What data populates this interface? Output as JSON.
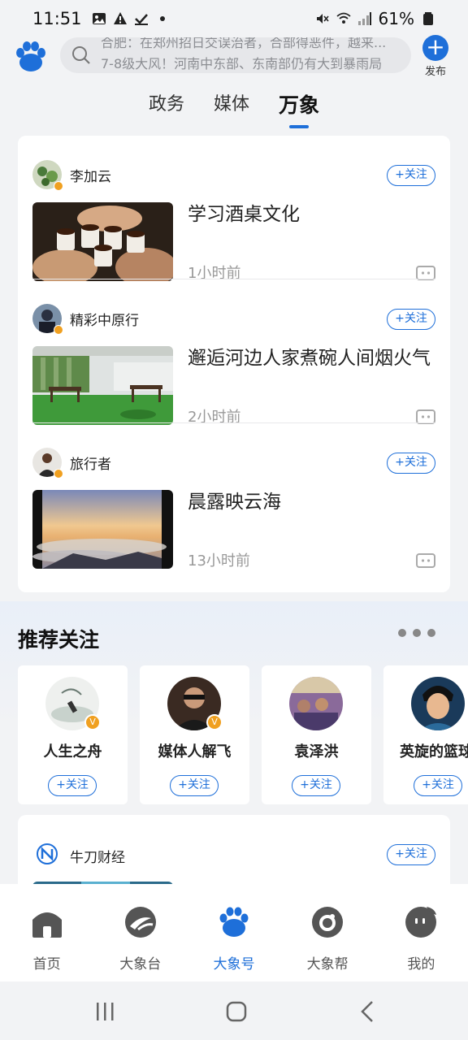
{
  "status_bar": {
    "time": "11:51",
    "battery": "61%"
  },
  "search": {
    "lines": [
      "合肥：在郑州招日交误治者，合部得恶件，越来...",
      "7-8级大风！河南中东部、东南部仍有大到暴雨局"
    ]
  },
  "header": {
    "publish_label": "发布"
  },
  "tabs": [
    {
      "label": "政务"
    },
    {
      "label": "媒体"
    },
    {
      "label": "万象"
    }
  ],
  "feed": {
    "follow_label": "+关注",
    "posts": [
      {
        "author": "李加云",
        "title": "学习酒桌文化",
        "time": "1小时前"
      },
      {
        "author": "精彩中原行",
        "title": "邂逅河边人家煮碗人间烟火气",
        "time": "2小时前"
      },
      {
        "author": "旅行者",
        "title": "晨露映云海",
        "time": "13小时前"
      }
    ]
  },
  "recommend": {
    "title": "推荐关注",
    "follow_label": "+关注",
    "cards": [
      {
        "name": "人生之舟"
      },
      {
        "name": "媒体人解飞"
      },
      {
        "name": "袁泽洪"
      },
      {
        "name": "英旋的篮球"
      }
    ]
  },
  "partial_post": {
    "author": "牛刀财经",
    "follow_label": "+关注"
  },
  "bottom_nav": [
    {
      "label": "首页"
    },
    {
      "label": "大象台"
    },
    {
      "label": "大象号"
    },
    {
      "label": "大象帮"
    },
    {
      "label": "我的"
    }
  ],
  "colors": {
    "accent": "#1e6fd9",
    "background": "#f2f3f5",
    "badge": "#f0a020"
  }
}
